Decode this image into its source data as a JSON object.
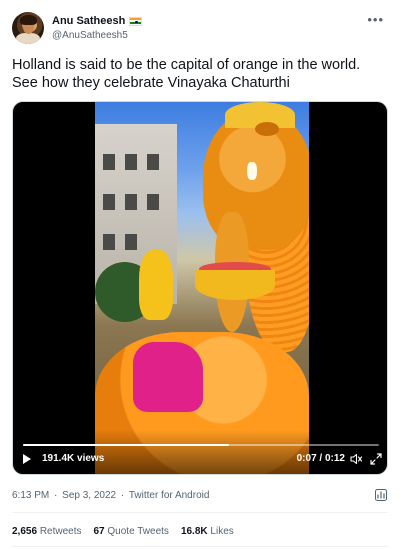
{
  "author": {
    "display_name": "Anu Satheesh",
    "handle": "@AnuSatheesh5",
    "flag_icon": "india-flag-icon"
  },
  "tweet": {
    "text": "Holland is said to be the capital of orange in the world. See how they celebrate Vinayaka Chaturthi"
  },
  "video": {
    "views": "191.4K views",
    "time": "0:07 / 0:12",
    "progress_fraction": 0.58,
    "icons": [
      "play-icon",
      "volume-icon",
      "fullscreen-icon"
    ]
  },
  "meta": {
    "time": "6:13 PM",
    "date": "Sep 3, 2022",
    "source": "Twitter for Android",
    "separator": "·"
  },
  "stats": {
    "retweets_count": "2,656",
    "retweets_label": "Retweets",
    "quotes_count": "67",
    "quotes_label": "Quote Tweets",
    "likes_count": "16.8K",
    "likes_label": "Likes"
  },
  "colors": {
    "primary_text": "#0f1419",
    "secondary_text": "#536471",
    "divider": "#eff3f4"
  }
}
